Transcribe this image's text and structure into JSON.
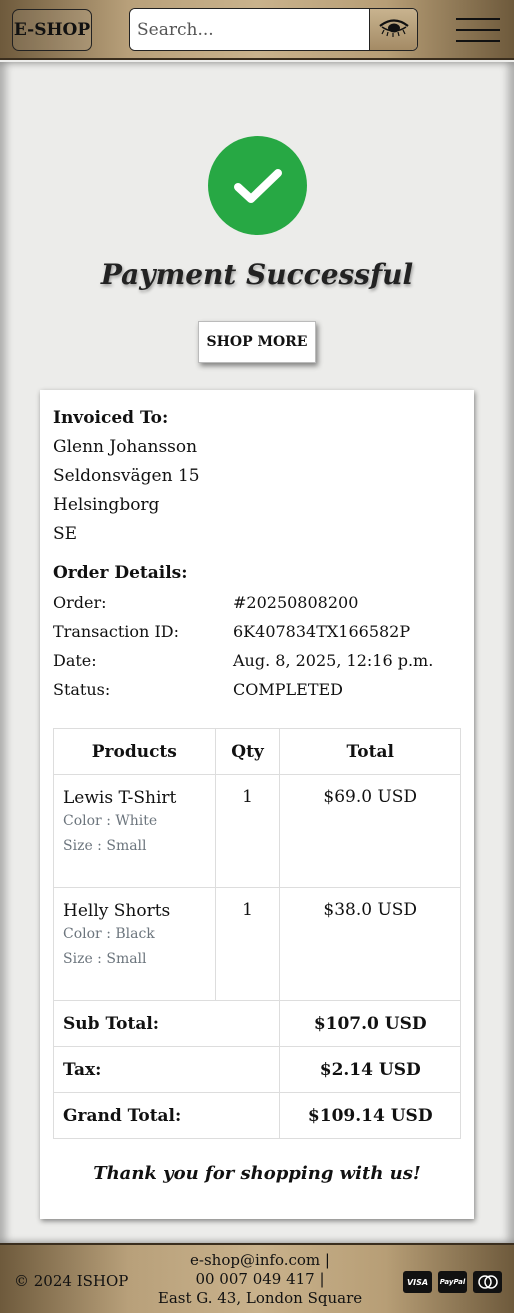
{
  "header": {
    "logo": "E-SHOP",
    "search_placeholder": "Search..."
  },
  "status": {
    "title": "Payment Successful",
    "shop_more": "SHOP MORE",
    "success_color": "#27a844"
  },
  "invoice": {
    "title": "Invoiced To:",
    "name": "Glenn Johansson",
    "street": "Seldonsvägen 15",
    "city": "Helsingborg",
    "country": "SE"
  },
  "order": {
    "title": "Order Details:",
    "rows": [
      {
        "label": "Order:",
        "value": "#20250808200"
      },
      {
        "label": "Transaction ID:",
        "value": "6K407834TX166582P"
      },
      {
        "label": "Date:",
        "value": "Aug. 8, 2025, 12:16 p.m."
      },
      {
        "label": "Status:",
        "value": "COMPLETED"
      }
    ]
  },
  "table": {
    "headers": [
      "Products",
      "Qty",
      "Total"
    ],
    "items": [
      {
        "name": "Lewis T-Shirt",
        "color": "Color : White",
        "size": "Size : Small",
        "qty": "1",
        "total": "$69.0 USD"
      },
      {
        "name": "Helly Shorts",
        "color": "Color : Black",
        "size": "Size : Small",
        "qty": "1",
        "total": "$38.0 USD"
      }
    ],
    "subtotal_label": "Sub Total:",
    "subtotal": "$107.0 USD",
    "tax_label": "Tax:",
    "tax": "$2.14 USD",
    "grand_label": "Grand Total:",
    "grand": "$109.14 USD"
  },
  "thanks": "Thank you for shopping with us!",
  "footer": {
    "copyright": "© 2024 ISHOP",
    "email": "e-shop@info.com  |",
    "phone": "00 007 049 417  |",
    "address": "East G. 43, London Square",
    "payments": [
      "VISA",
      "PayPal",
      "mastercard"
    ]
  }
}
